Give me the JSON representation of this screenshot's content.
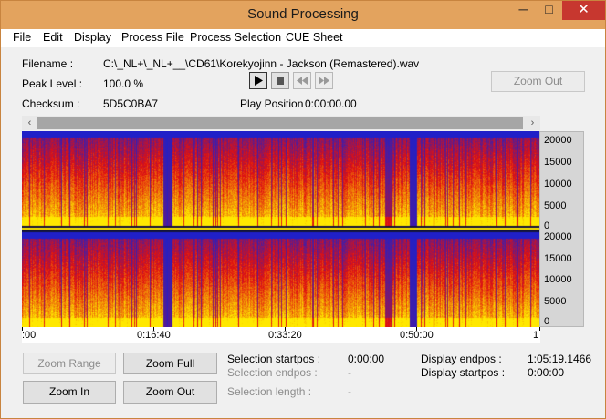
{
  "window": {
    "title": "Sound Processing",
    "controls": {
      "minimize": "─",
      "maximize": "□",
      "close": "✕"
    }
  },
  "menu": [
    "File",
    "Edit",
    "Display",
    "Process File",
    "Process Selection",
    "CUE Sheet"
  ],
  "info": {
    "filename_label": "Filename :",
    "filename_value": "C:\\_NL+\\_NL+__\\CD61\\Korekyojinn - Jackson (Remastered).wav",
    "peak_label": "Peak Level :",
    "peak_value": "100.0 %",
    "checksum_label": "Checksum :",
    "checksum_value": "5D5C0BA7",
    "play_position_label": "Play Position :",
    "play_position_value": "0:00:00.00"
  },
  "transport": {
    "play_icon": "play-icon",
    "stop_icon": "stop-icon",
    "rewind_icon": "rewind-icon",
    "forward_icon": "fast-forward-icon"
  },
  "zoom_out_top_label": "Zoom Out",
  "scrollbar": {
    "left_arrow": "‹",
    "right_arrow": "›"
  },
  "chart_data": {
    "type": "heatmap",
    "channels": 2,
    "ylim": [
      0,
      22050
    ],
    "y_ticks": [
      "20000",
      "15000",
      "10000",
      "5000",
      "0"
    ],
    "x_ticks": [
      ":00",
      "0:16:40",
      "0:33:20",
      "0:50:00",
      "1"
    ],
    "colors": {
      "low": "#2020c8",
      "mid": "#e01010",
      "high": "#ffe800"
    }
  },
  "buttons": {
    "zoom_range": "Zoom Range",
    "zoom_full": "Zoom Full",
    "zoom_in": "Zoom In",
    "zoom_out": "Zoom Out"
  },
  "selection": {
    "startpos_label": "Selection startpos :",
    "startpos_value": "0:00:00",
    "endpos_label": "Selection endpos :",
    "endpos_value": "-",
    "length_label": "Selection length :",
    "length_value": "-"
  },
  "display": {
    "endpos_label": "Display endpos :",
    "endpos_value": "1:05:19.1466",
    "startpos_label": "Display startpos :",
    "startpos_value": "0:00:00"
  }
}
